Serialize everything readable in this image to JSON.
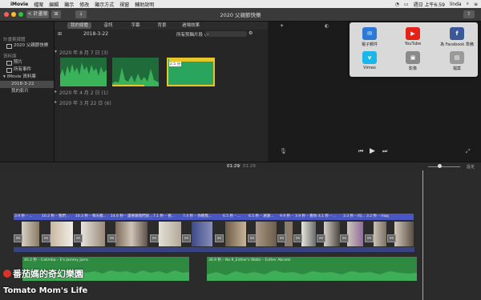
{
  "menubar": {
    "app": "iMovie",
    "items": [
      "檔案",
      "編輯",
      "顯示",
      "修改",
      "顯示方式",
      "視窗",
      "輔助說明"
    ],
    "clock": "週日 上午6:59",
    "user": "linda"
  },
  "toolbar": {
    "back_label": "< 計畫案",
    "project_title": "2020 父親節快樂"
  },
  "sidebar": {
    "section_projects": "計畫案媒體",
    "project_item": "2020 父親節快樂",
    "section_library": "資料庫",
    "items": [
      "照片",
      "所有事件",
      "iMovie 資料庫",
      "2018-3-22",
      "我的影片"
    ]
  },
  "browser": {
    "tabs": [
      "我的媒體",
      "音訊",
      "字幕",
      "背景",
      "過場效果"
    ],
    "event": "2018-3-22",
    "filter": "所有剪輯片段 ◇",
    "search_placeholder": "搜尋",
    "groups": [
      {
        "label": "2020 年 8 月 7 日  (3)"
      },
      {
        "label": "2020 年 4 月 2 日  (1)"
      },
      {
        "label": "2020 年 3 月 22 日  (6)"
      }
    ],
    "clip_badge": "2.5 分"
  },
  "share": {
    "items": [
      {
        "label": "電子郵件",
        "icon": "mail-icon",
        "color": "#2d7ad6"
      },
      {
        "label": "YouTube",
        "icon": "youtube-icon",
        "color": "#e62117"
      },
      {
        "label": "為 Facebook 準備",
        "icon": "facebook-icon",
        "color": "#3b5998"
      },
      {
        "label": "Vimeo",
        "icon": "vimeo-icon",
        "color": "#1ab7ea"
      },
      {
        "label": "影像",
        "icon": "image-icon",
        "color": "#8a8a8a"
      },
      {
        "label": "檔案",
        "icon": "file-icon",
        "color": "#9a9a9a"
      }
    ]
  },
  "timeline": {
    "current": "01:29",
    "total": "01:29",
    "settings": "設定",
    "clips": [
      "3.9 秒 – ...",
      "10.2 秒 – 我們...",
      "10.3 秒 – 每天都...",
      "14.6 秒 – 還要跟我們說...",
      "7.1 秒 – 爸...",
      "7.4 秒 – 你教我...",
      "",
      "6.5 秒 – ...",
      "6.5 秒 – 謝謝...",
      "9.9 秒 – ...",
      "3.9 秒 – 看你...",
      "4.1 秒 – ...",
      "3.3 秒 – 同...",
      "3.2 秒 – Happ..."
    ],
    "audio": [
      {
        "label": "40.2 秒 – Calimba – E's Jammy Jams"
      },
      {
        "label": "36.9 秒 – No.9_Esther's Waltz – Esther Abrami"
      }
    ]
  },
  "watermark": {
    "line1": "番茄媽的奇幻樂園",
    "line2": "Tomato Mom's Life"
  }
}
